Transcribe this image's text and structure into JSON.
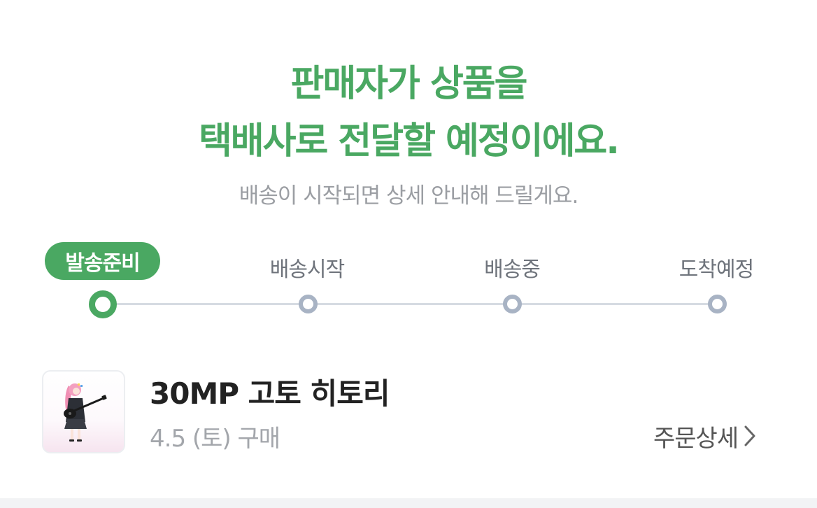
{
  "header": {
    "headline_line1": "판매자가 상품을",
    "headline_line2": "택배사로 전달할 예정이에요.",
    "subtext": "배송이 시작되면 상세 안내해 드릴게요."
  },
  "progress": {
    "steps": [
      {
        "label": "발송준비",
        "active": true
      },
      {
        "label": "배송시작",
        "active": false
      },
      {
        "label": "배송중",
        "active": false
      },
      {
        "label": "도착예정",
        "active": false
      }
    ]
  },
  "product": {
    "title": "30MP 고토 히토리",
    "meta": "4.5 (토) 구매",
    "thumbnail_icon": "figure-thumbnail",
    "order_detail_label": "주문상세",
    "order_detail_icon": "chevron-right-icon"
  },
  "colors": {
    "accent": "#4aa862",
    "inactive_dot": "#a8b3c4",
    "track": "#d6dbe2",
    "subtext": "#9b9ea3"
  }
}
